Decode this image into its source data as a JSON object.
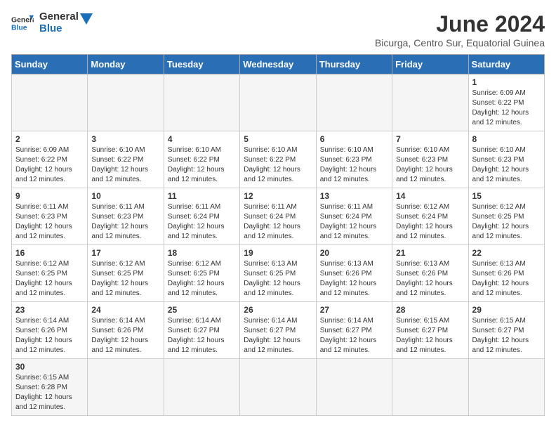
{
  "logo": {
    "text_general": "General",
    "text_blue": "Blue"
  },
  "title": "June 2024",
  "subtitle": "Bicurga, Centro Sur, Equatorial Guinea",
  "days_of_week": [
    "Sunday",
    "Monday",
    "Tuesday",
    "Wednesday",
    "Thursday",
    "Friday",
    "Saturday"
  ],
  "weeks": [
    [
      {
        "day": "",
        "info": ""
      },
      {
        "day": "",
        "info": ""
      },
      {
        "day": "",
        "info": ""
      },
      {
        "day": "",
        "info": ""
      },
      {
        "day": "",
        "info": ""
      },
      {
        "day": "",
        "info": ""
      },
      {
        "day": "1",
        "info": "Sunrise: 6:09 AM\nSunset: 6:22 PM\nDaylight: 12 hours and 12 minutes."
      }
    ],
    [
      {
        "day": "2",
        "info": "Sunrise: 6:09 AM\nSunset: 6:22 PM\nDaylight: 12 hours and 12 minutes."
      },
      {
        "day": "3",
        "info": "Sunrise: 6:10 AM\nSunset: 6:22 PM\nDaylight: 12 hours and 12 minutes."
      },
      {
        "day": "4",
        "info": "Sunrise: 6:10 AM\nSunset: 6:22 PM\nDaylight: 12 hours and 12 minutes."
      },
      {
        "day": "5",
        "info": "Sunrise: 6:10 AM\nSunset: 6:22 PM\nDaylight: 12 hours and 12 minutes."
      },
      {
        "day": "6",
        "info": "Sunrise: 6:10 AM\nSunset: 6:23 PM\nDaylight: 12 hours and 12 minutes."
      },
      {
        "day": "7",
        "info": "Sunrise: 6:10 AM\nSunset: 6:23 PM\nDaylight: 12 hours and 12 minutes."
      },
      {
        "day": "8",
        "info": "Sunrise: 6:10 AM\nSunset: 6:23 PM\nDaylight: 12 hours and 12 minutes."
      }
    ],
    [
      {
        "day": "9",
        "info": "Sunrise: 6:11 AM\nSunset: 6:23 PM\nDaylight: 12 hours and 12 minutes."
      },
      {
        "day": "10",
        "info": "Sunrise: 6:11 AM\nSunset: 6:23 PM\nDaylight: 12 hours and 12 minutes."
      },
      {
        "day": "11",
        "info": "Sunrise: 6:11 AM\nSunset: 6:24 PM\nDaylight: 12 hours and 12 minutes."
      },
      {
        "day": "12",
        "info": "Sunrise: 6:11 AM\nSunset: 6:24 PM\nDaylight: 12 hours and 12 minutes."
      },
      {
        "day": "13",
        "info": "Sunrise: 6:11 AM\nSunset: 6:24 PM\nDaylight: 12 hours and 12 minutes."
      },
      {
        "day": "14",
        "info": "Sunrise: 6:12 AM\nSunset: 6:24 PM\nDaylight: 12 hours and 12 minutes."
      },
      {
        "day": "15",
        "info": "Sunrise: 6:12 AM\nSunset: 6:25 PM\nDaylight: 12 hours and 12 minutes."
      }
    ],
    [
      {
        "day": "16",
        "info": "Sunrise: 6:12 AM\nSunset: 6:25 PM\nDaylight: 12 hours and 12 minutes."
      },
      {
        "day": "17",
        "info": "Sunrise: 6:12 AM\nSunset: 6:25 PM\nDaylight: 12 hours and 12 minutes."
      },
      {
        "day": "18",
        "info": "Sunrise: 6:12 AM\nSunset: 6:25 PM\nDaylight: 12 hours and 12 minutes."
      },
      {
        "day": "19",
        "info": "Sunrise: 6:13 AM\nSunset: 6:25 PM\nDaylight: 12 hours and 12 minutes."
      },
      {
        "day": "20",
        "info": "Sunrise: 6:13 AM\nSunset: 6:26 PM\nDaylight: 12 hours and 12 minutes."
      },
      {
        "day": "21",
        "info": "Sunrise: 6:13 AM\nSunset: 6:26 PM\nDaylight: 12 hours and 12 minutes."
      },
      {
        "day": "22",
        "info": "Sunrise: 6:13 AM\nSunset: 6:26 PM\nDaylight: 12 hours and 12 minutes."
      }
    ],
    [
      {
        "day": "23",
        "info": "Sunrise: 6:14 AM\nSunset: 6:26 PM\nDaylight: 12 hours and 12 minutes."
      },
      {
        "day": "24",
        "info": "Sunrise: 6:14 AM\nSunset: 6:26 PM\nDaylight: 12 hours and 12 minutes."
      },
      {
        "day": "25",
        "info": "Sunrise: 6:14 AM\nSunset: 6:27 PM\nDaylight: 12 hours and 12 minutes."
      },
      {
        "day": "26",
        "info": "Sunrise: 6:14 AM\nSunset: 6:27 PM\nDaylight: 12 hours and 12 minutes."
      },
      {
        "day": "27",
        "info": "Sunrise: 6:14 AM\nSunset: 6:27 PM\nDaylight: 12 hours and 12 minutes."
      },
      {
        "day": "28",
        "info": "Sunrise: 6:15 AM\nSunset: 6:27 PM\nDaylight: 12 hours and 12 minutes."
      },
      {
        "day": "29",
        "info": "Sunrise: 6:15 AM\nSunset: 6:27 PM\nDaylight: 12 hours and 12 minutes."
      }
    ],
    [
      {
        "day": "30",
        "info": "Sunrise: 6:15 AM\nSunset: 6:28 PM\nDaylight: 12 hours and 12 minutes."
      },
      {
        "day": "",
        "info": ""
      },
      {
        "day": "",
        "info": ""
      },
      {
        "day": "",
        "info": ""
      },
      {
        "day": "",
        "info": ""
      },
      {
        "day": "",
        "info": ""
      },
      {
        "day": "",
        "info": ""
      }
    ]
  ]
}
